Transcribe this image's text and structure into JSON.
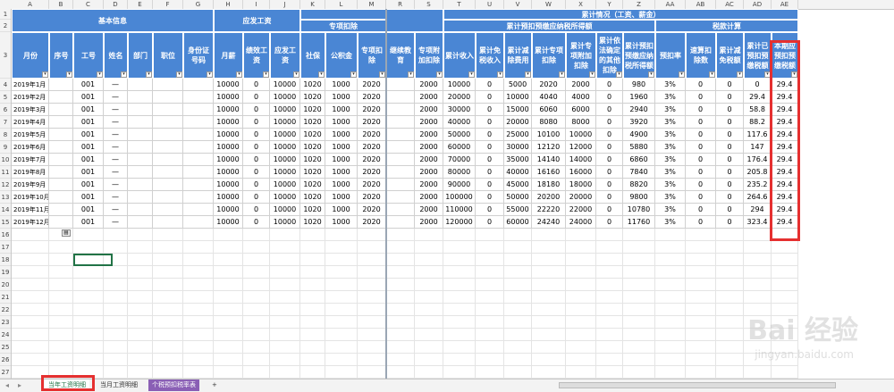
{
  "columns": [
    "A",
    "B",
    "C",
    "D",
    "E",
    "F",
    "G",
    "H",
    "I",
    "J",
    "K",
    "L",
    "M",
    "R",
    "S",
    "T",
    "U",
    "V",
    "W",
    "X",
    "Y",
    "Z",
    "AA",
    "AB",
    "AC",
    "AD",
    "AE"
  ],
  "rows": [
    "1",
    "2",
    "3",
    "4",
    "5",
    "6",
    "7",
    "8",
    "9",
    "10",
    "11",
    "12",
    "13",
    "14",
    "15",
    "16",
    "17",
    "18",
    "19",
    "20",
    "21",
    "22",
    "23",
    "24",
    "25",
    "26",
    "27"
  ],
  "groups": {
    "basic": "基本信息",
    "salary": "应发工资",
    "special": "专项扣除",
    "cumulative": "累计情况（工资、薪金）",
    "taxable": "累计预扣预缴应纳税所得额",
    "taxcalc": "税款计算"
  },
  "headers": [
    "月份",
    "序号",
    "工号",
    "姓名",
    "部门",
    "职位",
    "身份证号码",
    "月薪",
    "绩效工资",
    "应发工资",
    "社保",
    "公积金",
    "专项扣除",
    "继续教育",
    "专项附加扣除",
    "累计收入",
    "累计免税收入",
    "累计减除费用",
    "累计专项扣除",
    "累计专项附加扣除",
    "累计依法确定的其他扣除",
    "累计预扣预缴应纳税所得额",
    "预扣率",
    "速算扣除数",
    "累计减免税额",
    "累计已预扣预缴税额",
    "本期应预扣预缴税额"
  ],
  "data": [
    [
      "2019年1月",
      "",
      "001",
      "—",
      "",
      "",
      "",
      "10000",
      "0",
      "10000",
      "1020",
      "1000",
      "2020",
      "",
      "2000",
      "10000",
      "0",
      "5000",
      "2020",
      "2000",
      "0",
      "980",
      "3%",
      "0",
      "0",
      "0",
      "29.4"
    ],
    [
      "2019年2月",
      "",
      "001",
      "—",
      "",
      "",
      "",
      "10000",
      "0",
      "10000",
      "1020",
      "1000",
      "2020",
      "",
      "2000",
      "20000",
      "0",
      "10000",
      "4040",
      "4000",
      "0",
      "1960",
      "3%",
      "0",
      "0",
      "29.4",
      "29.4"
    ],
    [
      "2019年3月",
      "",
      "001",
      "—",
      "",
      "",
      "",
      "10000",
      "0",
      "10000",
      "1020",
      "1000",
      "2020",
      "",
      "2000",
      "30000",
      "0",
      "15000",
      "6060",
      "6000",
      "0",
      "2940",
      "3%",
      "0",
      "0",
      "58.8",
      "29.4"
    ],
    [
      "2019年4月",
      "",
      "001",
      "—",
      "",
      "",
      "",
      "10000",
      "0",
      "10000",
      "1020",
      "1000",
      "2020",
      "",
      "2000",
      "40000",
      "0",
      "20000",
      "8080",
      "8000",
      "0",
      "3920",
      "3%",
      "0",
      "0",
      "88.2",
      "29.4"
    ],
    [
      "2019年5月",
      "",
      "001",
      "—",
      "",
      "",
      "",
      "10000",
      "0",
      "10000",
      "1020",
      "1000",
      "2020",
      "",
      "2000",
      "50000",
      "0",
      "25000",
      "10100",
      "10000",
      "0",
      "4900",
      "3%",
      "0",
      "0",
      "117.6",
      "29.4"
    ],
    [
      "2019年6月",
      "",
      "001",
      "—",
      "",
      "",
      "",
      "10000",
      "0",
      "10000",
      "1020",
      "1000",
      "2020",
      "",
      "2000",
      "60000",
      "0",
      "30000",
      "12120",
      "12000",
      "0",
      "5880",
      "3%",
      "0",
      "0",
      "147",
      "29.4"
    ],
    [
      "2019年7月",
      "",
      "001",
      "—",
      "",
      "",
      "",
      "10000",
      "0",
      "10000",
      "1020",
      "1000",
      "2020",
      "",
      "2000",
      "70000",
      "0",
      "35000",
      "14140",
      "14000",
      "0",
      "6860",
      "3%",
      "0",
      "0",
      "176.4",
      "29.4"
    ],
    [
      "2019年8月",
      "",
      "001",
      "—",
      "",
      "",
      "",
      "10000",
      "0",
      "10000",
      "1020",
      "1000",
      "2020",
      "",
      "2000",
      "80000",
      "0",
      "40000",
      "16160",
      "16000",
      "0",
      "7840",
      "3%",
      "0",
      "0",
      "205.8",
      "29.4"
    ],
    [
      "2019年9月",
      "",
      "001",
      "—",
      "",
      "",
      "",
      "10000",
      "0",
      "10000",
      "1020",
      "1000",
      "2020",
      "",
      "2000",
      "90000",
      "0",
      "45000",
      "18180",
      "18000",
      "0",
      "8820",
      "3%",
      "0",
      "0",
      "235.2",
      "29.4"
    ],
    [
      "2019年10月",
      "",
      "001",
      "—",
      "",
      "",
      "",
      "10000",
      "0",
      "10000",
      "1020",
      "1000",
      "2020",
      "",
      "2000",
      "100000",
      "0",
      "50000",
      "20200",
      "20000",
      "0",
      "9800",
      "3%",
      "0",
      "0",
      "264.6",
      "29.4"
    ],
    [
      "2019年11月",
      "",
      "001",
      "—",
      "",
      "",
      "",
      "10000",
      "0",
      "10000",
      "1020",
      "1000",
      "2020",
      "",
      "2000",
      "110000",
      "0",
      "55000",
      "22220",
      "22000",
      "0",
      "10780",
      "3%",
      "0",
      "0",
      "294",
      "29.4"
    ],
    [
      "2019年12月",
      "",
      "001",
      "—",
      "",
      "",
      "",
      "10000",
      "0",
      "10000",
      "1020",
      "1000",
      "2020",
      "",
      "2000",
      "120000",
      "0",
      "60000",
      "24240",
      "24000",
      "0",
      "11760",
      "3%",
      "0",
      "0",
      "323.4",
      "29.4"
    ]
  ],
  "tabs": {
    "t1": "当年工资明细",
    "t2": "当月工资明细",
    "t3": "个税预扣税率表",
    "add": "+"
  },
  "watermark": {
    "main": "Bai 经验",
    "sub": "jingyan.baidu.com"
  },
  "colors": {
    "header": "#4a86d4",
    "accent": "#e53030",
    "sheetGreen": "#217346",
    "tabPurple": "#8a5fb5"
  }
}
